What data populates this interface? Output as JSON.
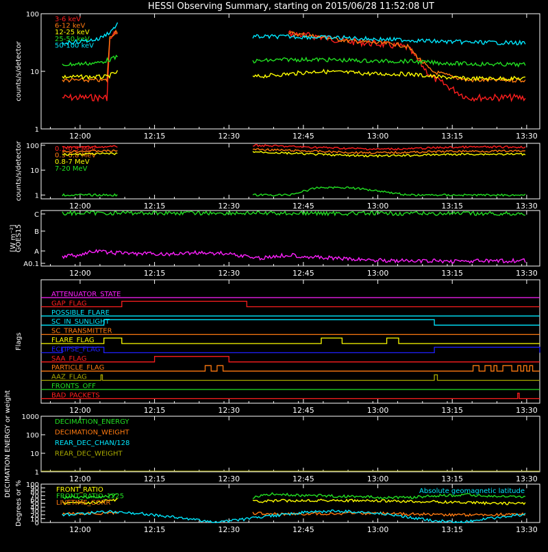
{
  "title": "HESSI Observing Summary, starting on 2015/06/28 11:52:08 UT",
  "time_labels": [
    "12:00",
    "12:15",
    "12:30",
    "12:45",
    "13:00",
    "13:15",
    "13:30"
  ],
  "colors": {
    "red": "#ff1e1e",
    "orange": "#ff7a10",
    "yellow": "#ffff00",
    "green": "#22e022",
    "cyan": "#00e8ff",
    "magenta": "#ff20ff",
    "blue": "#2020ff",
    "olive": "#a8a800"
  },
  "chart_data": [
    {
      "type": "line",
      "ylabel": "counts/s/detector",
      "yscale": "log",
      "ylim": [
        1,
        100
      ],
      "y_ticks": [
        "1",
        "10",
        "100"
      ],
      "legend_position": "top-left",
      "series": [
        {
          "name": "3-6 keV",
          "color": "red",
          "x": [
            11.94,
            12.06,
            12.09,
            12.1,
            12.12,
            12.13,
            12.2,
            12.3,
            12.4,
            12.5,
            12.6,
            12.7,
            12.8,
            12.9,
            13.0,
            13.05,
            13.1,
            13.18,
            13.3,
            13.5
          ],
          "y": [
            3.5,
            3.5,
            3.5,
            35,
            48,
            45,
            null,
            null,
            null,
            null,
            null,
            45,
            40,
            33,
            30,
            28,
            26,
            8,
            3.5,
            3.5
          ]
        },
        {
          "name": "6-12 keV",
          "color": "orange",
          "x": [
            11.94,
            12.06,
            12.09,
            12.1,
            12.12,
            12.13,
            12.2,
            12.3,
            12.4,
            12.5,
            12.6,
            12.7,
            12.8,
            12.9,
            13.0,
            13.05,
            13.1,
            13.18,
            13.3,
            13.5
          ],
          "y": [
            7,
            7,
            7,
            38,
            50,
            46,
            null,
            null,
            null,
            null,
            null,
            46,
            40,
            34,
            31,
            30,
            27,
            10,
            7,
            7
          ]
        },
        {
          "name": "12-25 keV",
          "color": "yellow",
          "x": [
            11.94,
            12.06,
            12.09,
            12.13,
            12.2,
            12.3,
            12.4,
            12.5,
            12.56,
            12.58,
            12.7,
            12.8,
            12.9,
            13.0,
            13.1,
            13.2,
            13.3,
            13.5
          ],
          "y": [
            8,
            8,
            8,
            10,
            null,
            null,
            null,
            null,
            null,
            8,
            9,
            10,
            9.5,
            9,
            9,
            8,
            7.5,
            7.5
          ]
        },
        {
          "name": "25-50 keV",
          "color": "green",
          "x": [
            11.94,
            12.0,
            12.06,
            12.1,
            12.13,
            12.2,
            12.3,
            12.4,
            12.5,
            12.56,
            12.58,
            12.7,
            12.8,
            12.9,
            13.0,
            13.1,
            13.2,
            13.3,
            13.5
          ],
          "y": [
            13,
            13.5,
            14,
            16,
            18,
            null,
            null,
            null,
            null,
            null,
            15,
            16,
            16,
            15.5,
            15,
            15,
            14,
            13.5,
            13
          ]
        },
        {
          "name": "50-100 keV",
          "color": "cyan",
          "x": [
            11.94,
            12.0,
            12.06,
            12.1,
            12.13,
            12.2,
            12.3,
            12.4,
            12.5,
            12.56,
            12.58,
            12.7,
            12.8,
            12.9,
            13.0,
            13.1,
            13.2,
            13.3,
            13.5
          ],
          "y": [
            31,
            33,
            36,
            48,
            70,
            null,
            null,
            null,
            null,
            null,
            40,
            40,
            39,
            38,
            36,
            35,
            33,
            32,
            31
          ]
        }
      ]
    },
    {
      "type": "line",
      "ylabel": "counts/s/detector",
      "yscale": "log",
      "ylim": [
        0.7,
        120
      ],
      "y_ticks": [
        "1",
        "10",
        "100"
      ],
      "legend_position": "top-left",
      "series": [
        {
          "name": "0.1-0.3 MeV",
          "color": "red",
          "x": [
            11.94,
            12.0,
            12.13,
            12.2,
            12.3,
            12.4,
            12.5,
            12.56,
            12.58,
            12.7,
            12.8,
            12.9,
            13.0,
            13.1,
            13.2,
            13.3,
            13.5
          ],
          "y": [
            80,
            85,
            88,
            null,
            null,
            null,
            null,
            null,
            100,
            90,
            82,
            75,
            70,
            72,
            80,
            85,
            85
          ]
        },
        {
          "name": "0.3-0.8 MeV",
          "color": "orange",
          "x": [
            11.94,
            12.0,
            12.13,
            12.2,
            12.3,
            12.4,
            12.5,
            12.56,
            12.58,
            12.7,
            12.8,
            12.9,
            13.0,
            13.1,
            13.2,
            13.3,
            13.5
          ],
          "y": [
            55,
            58,
            60,
            null,
            null,
            null,
            null,
            null,
            70,
            62,
            57,
            52,
            50,
            52,
            56,
            58,
            58
          ]
        },
        {
          "name": "0.8-7 MeV",
          "color": "yellow",
          "x": [
            11.94,
            12.0,
            12.13,
            12.2,
            12.3,
            12.4,
            12.5,
            12.56,
            12.58,
            12.7,
            12.8,
            12.9,
            13.0,
            13.1,
            13.2,
            13.3,
            13.5
          ],
          "y": [
            42,
            44,
            46,
            null,
            null,
            null,
            null,
            null,
            55,
            48,
            43,
            39,
            37,
            39,
            42,
            44,
            44
          ]
        },
        {
          "name": "7-20 MeV",
          "color": "green",
          "x": [
            11.94,
            12.0,
            12.13,
            12.2,
            12.3,
            12.4,
            12.5,
            12.56,
            12.58,
            12.7,
            12.8,
            12.9,
            13.0,
            13.1,
            13.2,
            13.3,
            13.5
          ],
          "y": [
            1,
            1,
            1,
            null,
            null,
            null,
            null,
            null,
            1,
            1,
            2,
            2,
            1.5,
            1,
            1,
            1,
            1
          ]
        }
      ]
    },
    {
      "type": "line",
      "ylabel": "GOES15",
      "ylabel_units": "[W m⁻²]",
      "yscale": "log",
      "ylim": [
        6.3e-09,
        1.1e-06
      ],
      "y_ticks": [
        "A0.1",
        "A",
        "B",
        "C"
      ],
      "series": [
        {
          "color": "green",
          "x": [
            11.94,
            12.0,
            12.2,
            12.4,
            12.6,
            12.8,
            13.0,
            13.2,
            13.4,
            13.5
          ],
          "y": [
            8.5e-07,
            8.7e-07,
            8.8e-07,
            8.7e-07,
            8.6e-07,
            8.5e-07,
            8.4e-07,
            8.3e-07,
            8.2e-07,
            8.2e-07
          ]
        },
        {
          "color": "magenta",
          "x": [
            11.94,
            12.0,
            12.05,
            12.1,
            12.2,
            12.3,
            12.4,
            12.5,
            12.6,
            12.7,
            12.8,
            12.9,
            13.0,
            13.1,
            13.2,
            13.3,
            13.4,
            13.5
          ],
          "y": [
            1.5e-08,
            1.8e-08,
            2.5e-08,
            2.2e-08,
            2e-08,
            1.9e-08,
            2.2e-08,
            2e-08,
            1.3e-08,
            1.8e-08,
            1.4e-08,
            1.2e-08,
            1.1e-08,
            1e-08,
            1e-08,
            1e-08,
            1e-08,
            1.05e-08
          ]
        }
      ]
    },
    {
      "type": "line",
      "ylabel": "Flags",
      "series": [
        {
          "name": "ATTENUATOR_STATE",
          "color": "magenta",
          "x_on": []
        },
        {
          "name": "GAP_FLAG",
          "color": "red",
          "x_on": [
            [
              12.14,
              12.56
            ]
          ]
        },
        {
          "name": "POSSIBLE_FLARE",
          "color": "cyan",
          "x_on": []
        },
        {
          "name": "SC_IN_SUNLIGHT",
          "color": "cyan",
          "x_on": [
            [
              12.08,
              13.19
            ]
          ]
        },
        {
          "name": "SC_TRANSMITTER",
          "color": "orange",
          "x_on": []
        },
        {
          "name": "FLARE_FLAG",
          "color": "yellow",
          "x_on": [
            [
              12.08,
              12.14
            ],
            [
              12.81,
              12.88
            ],
            [
              13.03,
              13.07
            ]
          ]
        },
        {
          "name": "ECLIPSE_FLAG",
          "color": "blue",
          "x_on": [
            [
              11.94,
              12.08
            ],
            [
              13.19,
              13.55
            ]
          ]
        },
        {
          "name": "SAA_FLAG",
          "color": "red",
          "x_on": [
            [
              12.25,
              12.5
            ]
          ]
        },
        {
          "name": "PARTICLE_FLAG",
          "color": "orange",
          "x_on": [
            [
              12.42,
              12.44
            ],
            [
              12.46,
              12.48
            ],
            [
              13.32,
              13.34
            ],
            [
              13.36,
              13.38
            ],
            [
              13.39,
              13.4
            ],
            [
              13.42,
              13.45
            ],
            [
              13.47,
              13.48
            ],
            [
              13.49,
              13.5
            ],
            [
              13.51,
              13.52
            ]
          ]
        },
        {
          "name": "AAZ_FLAG",
          "color": "olive",
          "x_on": [
            [
              12.07,
              12.075
            ],
            [
              13.19,
              13.2
            ]
          ]
        },
        {
          "name": "FRONTS_OFF",
          "color": "green",
          "x_on": []
        },
        {
          "name": "BAD_PACKETS",
          "color": "red",
          "x_on": [
            [
              13.47,
              13.475
            ]
          ]
        }
      ]
    },
    {
      "type": "line",
      "ylabel": "DECIMATION ENERGY or weight",
      "yscale": "log",
      "ylim": [
        1,
        1000
      ],
      "y_ticks": [
        "1",
        "10",
        "100",
        "1000"
      ],
      "series": [
        {
          "name": "DECIMATION_ENERGY",
          "color": "green",
          "x": [
            11.94,
            13.5
          ],
          "y": [
            1,
            1
          ]
        },
        {
          "name": "DECIMATION_WEIGHT",
          "color": "orange",
          "x": [
            11.94,
            13.5
          ],
          "y": [
            1,
            1
          ]
        },
        {
          "name": "REAR_DEC_CHAN/128",
          "color": "cyan",
          "x": [
            11.94,
            13.5
          ],
          "y": [
            1,
            1
          ]
        },
        {
          "name": "REAR_DEC_WEIGHT",
          "color": "olive",
          "x": [
            11.94,
            13.5
          ],
          "y": [
            1,
            1
          ]
        }
      ]
    },
    {
      "type": "line",
      "ylabel": "Degrees or %",
      "ylim": [
        0,
        100
      ],
      "y_ticks": [
        "0",
        "10",
        "20",
        "30",
        "40",
        "50",
        "60",
        "70",
        "80",
        "90",
        "100"
      ],
      "annotation": "Absolute geomagnetic latitude",
      "series": [
        {
          "name": "FRONT_RATIO",
          "color": "yellow",
          "x": [
            11.94,
            12.0,
            12.07,
            12.09,
            12.13,
            12.2,
            12.3,
            12.4,
            12.5,
            12.56,
            12.58,
            12.7,
            12.8,
            12.9,
            13.0,
            13.1,
            13.2,
            13.3,
            13.4,
            13.5
          ],
          "y": [
            50,
            52,
            52,
            58,
            60,
            null,
            null,
            null,
            null,
            null,
            55,
            57,
            58,
            57,
            56,
            55,
            54,
            52,
            50,
            50
          ]
        },
        {
          "name": "FRONT_RATIO_1225",
          "color": "green",
          "x": [
            11.94,
            12.0,
            12.07,
            12.09,
            12.13,
            12.2,
            12.3,
            12.4,
            12.5,
            12.56,
            12.58,
            12.65,
            12.7,
            12.8,
            12.9,
            13.0,
            13.1,
            13.2,
            13.3,
            13.4,
            13.5
          ],
          "y": [
            65,
            66,
            66,
            70,
            72,
            null,
            null,
            null,
            null,
            null,
            65,
            75,
            72,
            70,
            68,
            66,
            65,
            70,
            72,
            68,
            66
          ]
        },
        {
          "name": "LIVETIME_CORR",
          "color": "orange",
          "x": [
            11.94,
            12.0,
            12.13,
            12.2,
            12.3,
            12.4,
            12.5,
            12.56,
            12.58,
            12.7,
            12.8,
            12.9,
            13.0,
            13.1,
            13.2,
            13.3,
            13.4,
            13.5
          ],
          "y": [
            22,
            23,
            25,
            null,
            null,
            null,
            null,
            null,
            24,
            22,
            23,
            24,
            24,
            22,
            21,
            20,
            21,
            22
          ]
        },
        {
          "name": "Absolute geomagnetic latitude",
          "color": "cyan",
          "x": [
            11.94,
            12.02,
            12.1,
            12.2,
            12.3,
            12.4,
            12.47,
            12.55,
            12.65,
            12.75,
            12.85,
            12.93,
            13.0,
            13.1,
            13.18,
            13.28,
            13.35,
            13.43,
            13.5
          ],
          "y": [
            20,
            24,
            28,
            24,
            15,
            6,
            1,
            8,
            18,
            26,
            30,
            28,
            24,
            14,
            5,
            0,
            8,
            16,
            22
          ]
        }
      ]
    }
  ]
}
